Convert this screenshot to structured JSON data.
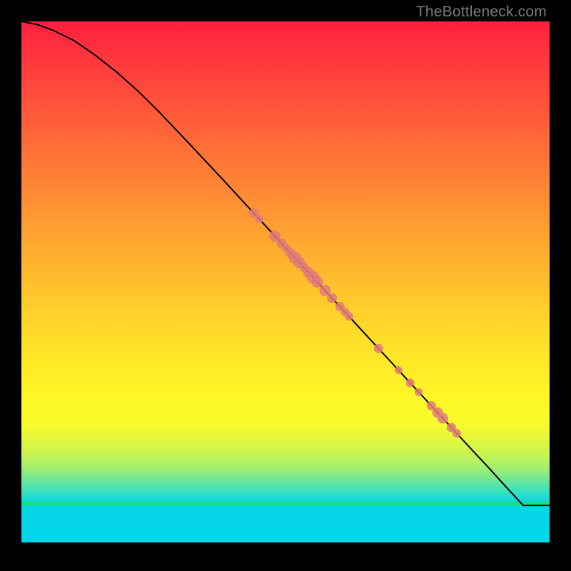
{
  "watermark": "TheBottleneck.com",
  "colors": {
    "curve_stroke": "#000000",
    "point_fill": "#e07a7a",
    "point_fill_alpha": 0.85
  },
  "chart_data": {
    "type": "line",
    "title": "",
    "xlabel": "",
    "ylabel": "",
    "xlim": [
      0,
      100
    ],
    "ylim": [
      0,
      100
    ],
    "series": [
      {
        "name": "bottleneck-curve",
        "x": [
          0,
          3,
          6,
          10,
          14,
          18,
          22,
          26,
          32,
          38,
          44,
          50,
          56,
          62,
          68,
          74,
          80,
          85,
          88.5,
          91,
          95,
          100
        ],
        "y": [
          100,
          99.4,
          98.3,
          96.3,
          93.5,
          90.3,
          86.7,
          82.7,
          76.3,
          69.8,
          63.2,
          56.6,
          50.0,
          43.4,
          36.8,
          30.2,
          23.6,
          18.1,
          14.3,
          11.5,
          7.1,
          7.1
        ]
      }
    ],
    "points": {
      "name": "marker-points",
      "x": [
        44.0,
        45.0,
        48.0,
        49.3,
        50.2,
        51.0,
        51.8,
        52.6,
        53.5,
        54.3,
        55.2,
        56.0,
        57.5,
        58.8,
        60.3,
        61.3,
        62.0,
        67.6,
        71.4,
        73.6,
        75.2,
        77.6,
        78.8,
        79.8,
        81.4,
        82.4
      ],
      "r": [
        6.5,
        6.0,
        8.0,
        7.0,
        6.0,
        7.0,
        8.5,
        8.0,
        6.5,
        7.5,
        9.0,
        8.0,
        8.0,
        7.0,
        6.5,
        6.0,
        6.0,
        6.5,
        5.5,
        6.0,
        5.5,
        6.5,
        7.5,
        7.5,
        6.5,
        6.0
      ]
    }
  }
}
